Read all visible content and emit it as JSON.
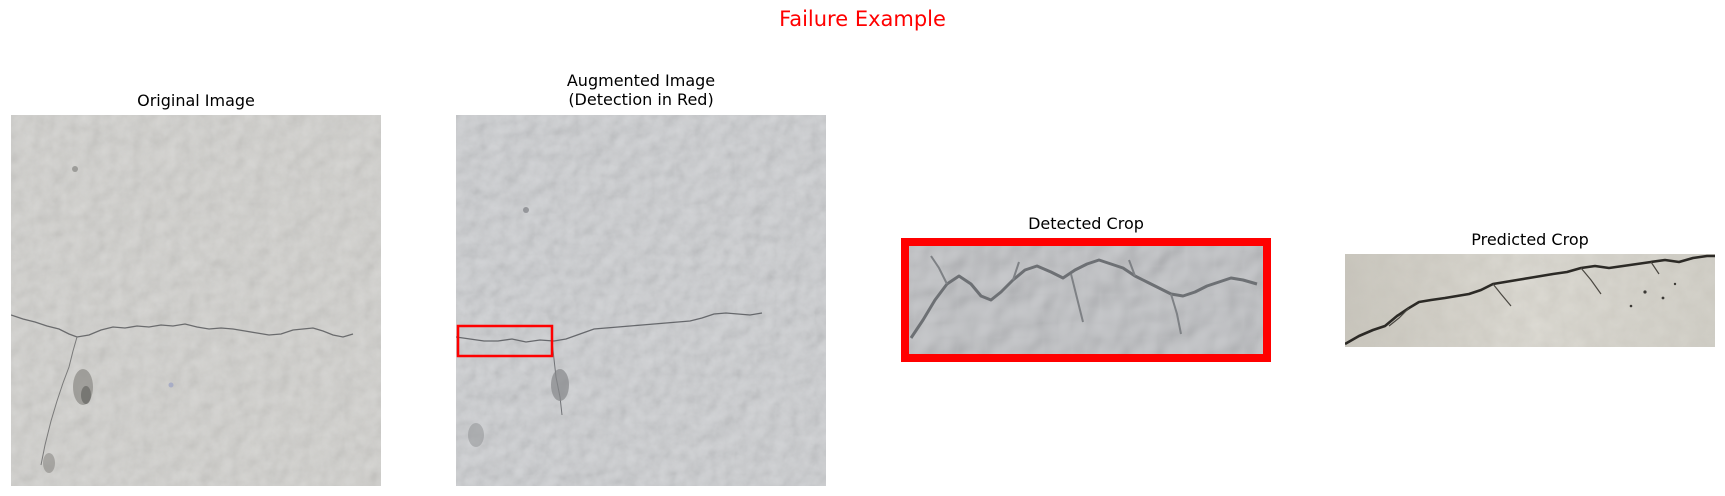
{
  "figure": {
    "suptitle": "Failure Example",
    "suptitle_color": "#ff0000"
  },
  "panels": [
    {
      "title": "Original Image",
      "image": "concrete-wall-photo"
    },
    {
      "title": "Augmented Image\n(Detection in Red)",
      "image": "augmented-concrete-wall-photo",
      "detection_box_color": "#ff0000"
    },
    {
      "title": "Detected Crop",
      "image": "detected-crack-crop",
      "border_color": "#ff0000"
    },
    {
      "title": "Predicted Crop",
      "image": "predicted-crack-crop"
    }
  ]
}
